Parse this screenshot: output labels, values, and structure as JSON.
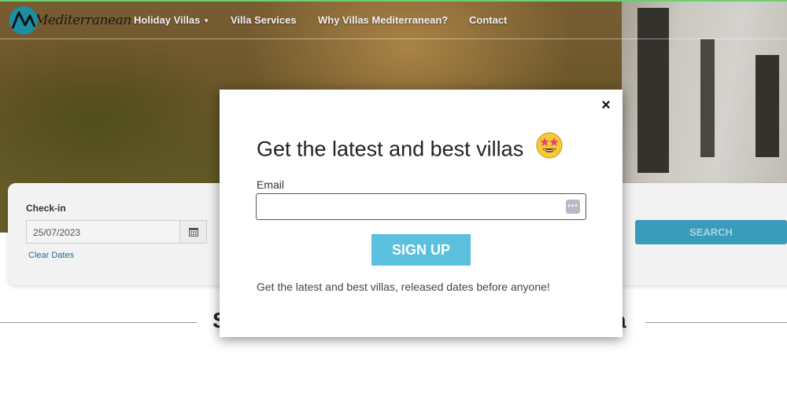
{
  "nav": {
    "logo_text": "Mediterranean",
    "items": [
      {
        "label": "Holiday Villas",
        "has_dropdown": true
      },
      {
        "label": "Villa Services"
      },
      {
        "label": "Why Villas Mediterranean?"
      },
      {
        "label": "Contact"
      }
    ]
  },
  "search": {
    "checkin_label": "Check-in",
    "checkin_value": "25/07/2023",
    "clear_dates": "Clear Dates",
    "search_button": "SEARCH"
  },
  "section": {
    "heading_left": "S",
    "heading_right": "a"
  },
  "modal": {
    "title": "Get the latest and best villas",
    "emoji": "star-struck-emoji",
    "email_label": "Email",
    "email_value": "",
    "signup_button": "SIGN UP",
    "footer_text": "Get the latest and best villas, released dates before anyone!",
    "close_symbol": "×"
  },
  "colors": {
    "accent": "#5bc0de",
    "search_button": "#3a9cbb",
    "logo": "#1c8fa4",
    "link": "#1f6f8b"
  }
}
